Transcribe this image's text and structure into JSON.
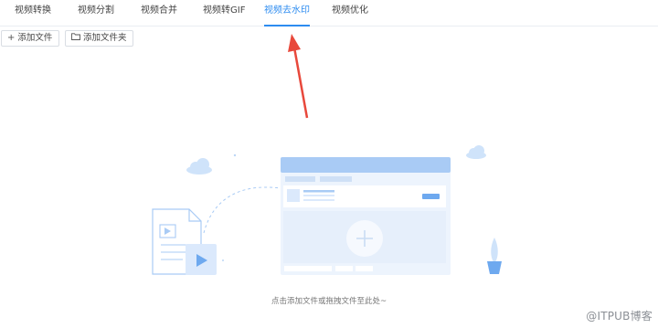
{
  "tabs": [
    {
      "label": "视频转换"
    },
    {
      "label": "视频分割"
    },
    {
      "label": "视频合并"
    },
    {
      "label": "视频转GIF"
    },
    {
      "label": "视频去水印"
    },
    {
      "label": "视频优化"
    }
  ],
  "active_tab": "视频去水印",
  "toolbar": {
    "add_file_label": "添加文件",
    "add_file_icon": "plus-icon",
    "add_folder_label": "添加文件夹",
    "add_folder_icon": "folder-icon"
  },
  "drop_zone": {
    "hint": "点击添加文件或拖拽文件至此处~"
  },
  "watermark": "@ITPUB博客",
  "colors": {
    "accent": "#2d8cf0",
    "arrow": "#e8483b",
    "illustration_light": "#e8f1fd",
    "illustration_mid": "#a9cbf5"
  }
}
